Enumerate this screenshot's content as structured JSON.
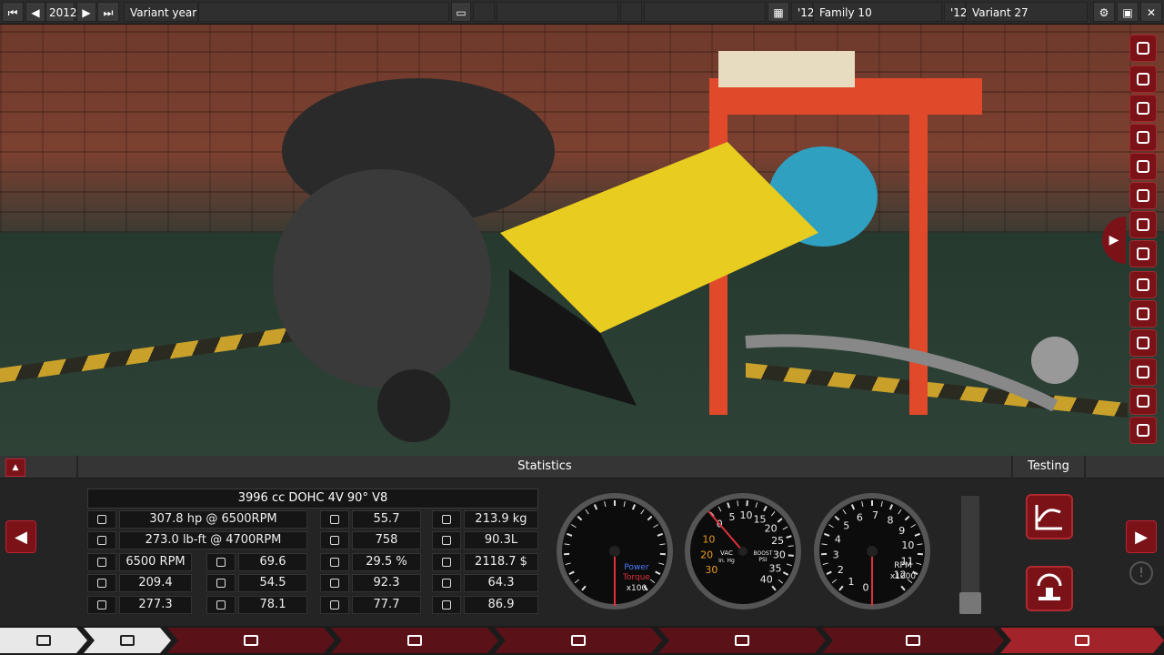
{
  "topbar": {
    "year": "2012",
    "variant_year_label": "Variant year",
    "family_year": "'12",
    "family_name": "Family 10",
    "variant_year": "'12",
    "variant_name": "Variant 27"
  },
  "panel": {
    "statistics_title": "Statistics",
    "testing_title": "Testing",
    "engine_title": "3996 cc DOHC 4V 90° V8",
    "col1": [
      "307.8 hp @ 6500RPM",
      "273.0 lb-ft @ 4700RPM"
    ],
    "col1_icons": [
      "power-icon",
      "torque-wrench-icon"
    ],
    "col1b": [
      "6500 RPM",
      "209.4",
      "277.3"
    ],
    "col1b_icons": [
      "rpm-icon",
      "gauge-icon",
      "cooling-icon"
    ],
    "col2": [
      "69.6",
      "54.5",
      "78.1"
    ],
    "col2_icons": [
      "radiator-icon",
      "smoothness-icon",
      "sound-icon"
    ],
    "col3": [
      "55.7",
      "758",
      "29.5 %",
      "92.3",
      "77.7"
    ],
    "col3_icons": [
      "engine-block-icon",
      "efficiency-icon",
      "fuel-can-icon",
      "fuel-pump-icon",
      "emissions-icon"
    ],
    "col4": [
      "213.9 kg",
      "90.3L",
      "2118.7 $",
      "64.3",
      "86.9"
    ],
    "col4_icons": [
      "weight-icon",
      "size-icon",
      "cost-icon",
      "service-icon",
      "reliability-icon"
    ]
  },
  "gauges": {
    "power_label": "Power",
    "torque_label": "Torque",
    "power_unit": "x100",
    "vac_label": "VAC",
    "vac_unit": "In. Hg",
    "boost_label": "BOOST",
    "boost_unit": "PSI",
    "boost_ticks": [
      "0",
      "5",
      "10",
      "15",
      "20",
      "25",
      "30",
      "35",
      "40"
    ],
    "vac_ticks": [
      "10",
      "20",
      "30"
    ],
    "rpm_label": "RPM",
    "rpm_unit": "x1000",
    "rpm_ticks": [
      "0",
      "1",
      "2",
      "3",
      "4",
      "5",
      "6",
      "7",
      "8",
      "9",
      "10",
      "11",
      "12"
    ]
  },
  "colors": {
    "accent": "#7a1218",
    "accent_bright": "#b02a30",
    "power_blue": "#4a7cff",
    "torque_red": "#e0303a",
    "boost_orange": "#e89a20"
  }
}
